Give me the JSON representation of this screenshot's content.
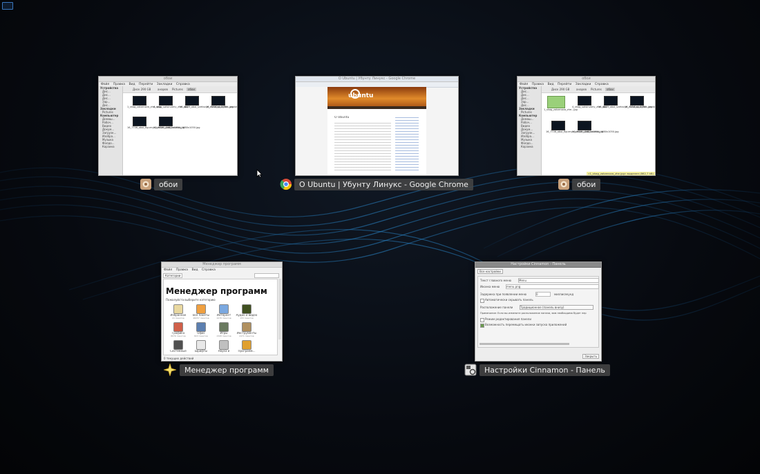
{
  "workspace_indicator": "",
  "windows": [
    {
      "id": "nemo-1",
      "title": "обои",
      "caption": "обои",
      "icon": "nemo-file-manager-icon",
      "menu": [
        "Файл",
        "Правка",
        "Вид",
        "Перейти",
        "Закладки",
        "Справка"
      ],
      "path": [
        "Диск 290 GB",
        "анаров",
        "Pictures",
        "обои"
      ],
      "sidebar_sections": [
        "Устройства",
        "Закладки",
        "Компьютер"
      ],
      "sidebar_items": [
        "Дис...",
        "Дис...",
        "Дис...",
        "Зар...",
        "Дис...",
        "Pictures",
        "Домаш...",
        "Рабоч...",
        "Видео",
        "Докум...",
        "Загрузк...",
        "Изобра...",
        "Музыка",
        "Фолдо...",
        "Корзина"
      ],
      "files": [
        {
          "name": "1_shag_zatzenova_zhe...jpg"
        },
        {
          "name": "4_shag_sotsinvskiy_zhe...jpg"
        },
        {
          "name": "16_6639_oboi_svetovye_variatny_1680...jpg"
        },
        {
          "name": "16_7154_oboi_tsvt_zaplomi_1680x1050.jpg"
        },
        {
          "name": "16_7706_oboi_figurnye_variatn_1680x1050.jpg"
        },
        {
          "name": "16_9626_oboi_kosmos_1680x1050.jpg"
        }
      ],
      "status": ""
    },
    {
      "id": "chrome",
      "title": "O Ubuntu | Убунту Линукс - Google Chrome",
      "caption": "О Ubuntu | Убунту Линукс - Google Chrome",
      "icon": "chrome-icon",
      "page_heading": "О Ubuntu",
      "logo_text": "ubuntu"
    },
    {
      "id": "nemo-2",
      "title": "обои",
      "caption": "обои",
      "icon": "nemo-file-manager-icon",
      "menu": [
        "Файл",
        "Правка",
        "Вид",
        "Перейти",
        "Закладки",
        "Справка"
      ],
      "path": [
        "Диск 290 GB",
        "анаров",
        "Pictures",
        "обои"
      ],
      "status": "«1_shag_zatzenova_zhe.jpg» выделен (862,7 kB)"
    },
    {
      "id": "mintinstall",
      "title": "Менеджер программ",
      "caption": "Менеджер программ",
      "icon": "software-manager-star-icon",
      "menu": [
        "Файл",
        "Правка",
        "Вид",
        "Справка"
      ],
      "toolbar_label": "Категории",
      "heading": "Менеджер программ",
      "subheading": "Пожалуйста выберите категорию",
      "categories": [
        {
          "label": "Избранное",
          "count": "21 пакетов",
          "color": "#e9d8a0",
          "icon": "favorites-icon"
        },
        {
          "label": "Все пакеты",
          "count": "48257 пакетов",
          "color": "#f0a040",
          "icon": "all-packages-icon"
        },
        {
          "label": "Интернет",
          "count": "1078 пакетов",
          "color": "#7aa8e0",
          "icon": "internet-icon"
        },
        {
          "label": "Аудио и видео",
          "count": "155 пакетов",
          "color": "#405020",
          "icon": "audio-video-icon"
        },
        {
          "label": "Графика",
          "count": "8676 пакетов",
          "color": "#d0604a",
          "icon": "graphics-icon"
        },
        {
          "label": "Офис",
          "count": "823 пакетов",
          "color": "#5c7fb0",
          "icon": "office-icon"
        },
        {
          "label": "Игры",
          "count": "1508 пакетов",
          "color": "#6a7a60",
          "icon": "games-icon"
        },
        {
          "label": "Инструменты",
          "count": "2471 пакетов",
          "color": "#b09060",
          "icon": "tools-icon"
        },
        {
          "label": "Системные",
          "count": "",
          "color": "#505050",
          "icon": "system-icon"
        },
        {
          "label": "Шрифты",
          "count": "",
          "color": "#e8e8e8",
          "icon": "fonts-icon"
        },
        {
          "label": "Наука и",
          "count": "",
          "color": "#c0c0c0",
          "icon": "science-icon"
        },
        {
          "label": "Программ...",
          "count": "",
          "color": "#e0a030",
          "icon": "programming-icon"
        }
      ],
      "status": "0 текущих действий"
    },
    {
      "id": "cinnamon-settings",
      "title": "Настройки Cinnamon - Панель",
      "caption": "Настройки Cinnamon - Панель",
      "icon": "cinnamon-settings-icon",
      "all_settings_button": "Все настройки",
      "fields": [
        {
          "label": "Текст главного меню",
          "value": "Menu"
        },
        {
          "label": "Иконка меню",
          "value": "menu.png"
        },
        {
          "label": "Задержка при появлении меню",
          "value": "0",
          "unit": "миллисекунд"
        }
      ],
      "checkbox_autohide": "Автоматически скрывать панель",
      "layout_label": "Расположение панели",
      "layout_value": "Традиционное (панель внизу)",
      "note": "Примечание: Если вы измените расположение панели, вам необходимо будет пер",
      "checkbox_edit": "Режим редактирования панели",
      "checkbox_drag": "Возможность перемещать иконки запуска приложений",
      "close_button": "Закрыть"
    }
  ],
  "colors": {
    "background": "#070a10",
    "swirl": "#1e6fa8",
    "caption_bg": "#464646",
    "chrome_banner": "#d87a1e"
  }
}
